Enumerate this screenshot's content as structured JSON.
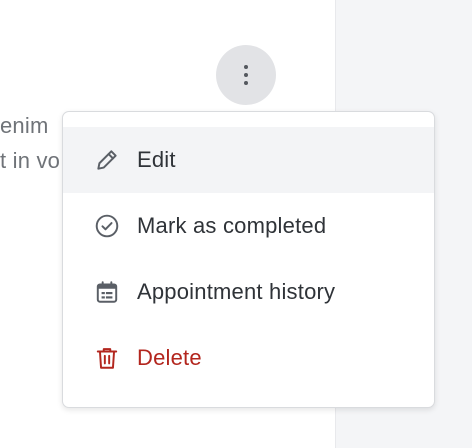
{
  "background": {
    "line_1": "enim",
    "line_2": "t in vo"
  },
  "kebab": {
    "icon": "more-vertical-icon"
  },
  "menu": {
    "items": [
      {
        "label": "Edit",
        "icon": "pencil-icon",
        "active": true
      },
      {
        "label": "Mark as completed",
        "icon": "check-circle-icon"
      },
      {
        "label": "Appointment history",
        "icon": "calendar-icon"
      },
      {
        "label": "Delete",
        "icon": "trash-icon",
        "danger": true
      }
    ]
  },
  "colors": {
    "text": "#2f3338",
    "icon": "#5a5f66",
    "danger": "#b3261e",
    "active_bg": "#f3f4f6",
    "side_panel": "#f4f5f7"
  }
}
